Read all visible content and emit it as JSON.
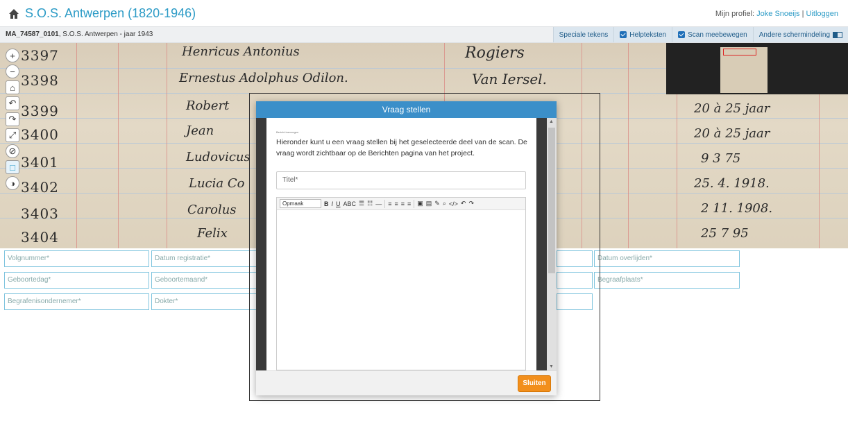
{
  "header": {
    "title": "S.O.S. Antwerpen (1820-1946)",
    "profile_label": "Mijn profiel:",
    "profile_user": "Joke Snoeijs",
    "separator": "|",
    "logout": "Uitloggen"
  },
  "subbar": {
    "id": "MA_74587_0101",
    "crumb": ", S.O.S. Antwerpen - jaar 1943",
    "tools": {
      "special_chars": "Speciale tekens",
      "helptexts": "Helpteksten",
      "scan_follow": "Scan meebewegen",
      "other_layout": "Andere schermindeling"
    }
  },
  "scan": {
    "numbers": [
      "3397",
      "3398",
      "3399",
      "3400",
      "3401",
      "3402",
      "3403",
      "3404"
    ],
    "names": [
      "Henricus Antonius",
      "Ernestus Adolphus Odilon.",
      "Robert",
      "Jean",
      "Ludovicus",
      "Lucia Co",
      "Carolus",
      "Felix"
    ],
    "surnames": [
      "Rogiers",
      "Van Iersel."
    ],
    "dates": [
      "20 à 25 jaar",
      "20 à 25 jaar",
      "9  3  75",
      "25. 4. 1918.",
      "2  11. 1908.",
      "25  7  95"
    ]
  },
  "fields": {
    "volgnummer": "Volgnummer*",
    "datum_registratie": "Datum registratie*",
    "datum_overlijden": "Datum overlijden*",
    "geboortedag": "Geboortedag*",
    "geboortemaand": "Geboortemaand*",
    "begraafplaats": "Begraafplaats*",
    "begrafenisondernemer": "Begrafenisondernemer*",
    "dokter": "Dokter*"
  },
  "modal": {
    "title": "Vraag stellen",
    "tiny_label": "Bericht toevoegen",
    "intro": "Hieronder kunt u een vraag stellen bij het geselecteerde deel van de scan. De vraag wordt zichtbaar op de Berichten pagina van het project.",
    "titel_placeholder": "Titel*",
    "format_select": "Opmaak",
    "close": "Sluiten"
  }
}
